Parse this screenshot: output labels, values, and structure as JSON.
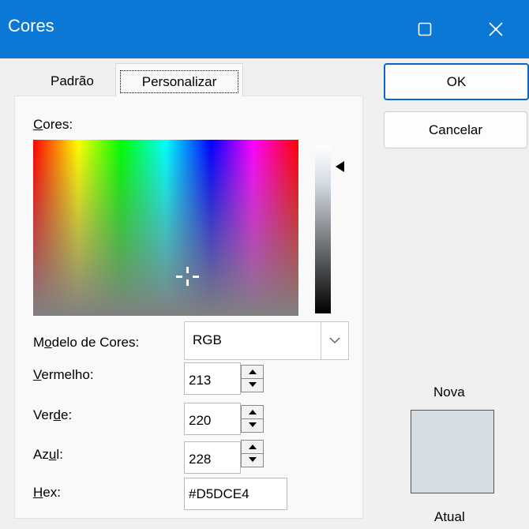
{
  "window": {
    "title": "Cores",
    "maximize_icon": "maximize-icon",
    "close_icon": "close-icon"
  },
  "tabs": [
    {
      "label": "Padrão",
      "selected": false
    },
    {
      "label": "Personalizar",
      "selected": true
    }
  ],
  "colors_label": {
    "mnemonic": "C",
    "rest": "ores:"
  },
  "color_model": {
    "label_pre": "M",
    "label_mnemonic": "o",
    "label_post": "delo de Cores:",
    "value": "RGB"
  },
  "red": {
    "label_mnemonic": "V",
    "label_rest": "ermelho:",
    "value": "213"
  },
  "green": {
    "label_pre": "Ver",
    "label_mnemonic": "d",
    "label_post": "e:",
    "value": "220"
  },
  "blue": {
    "label_pre": "Az",
    "label_mnemonic": "u",
    "label_post": "l:",
    "value": "228"
  },
  "hex": {
    "label_mnemonic": "H",
    "label_rest": "ex:",
    "value": "#D5DCE4"
  },
  "buttons": {
    "ok": "OK",
    "cancel": "Cancelar"
  },
  "preview": {
    "new_label": "Nova",
    "current_label": "Atual",
    "color": "#D5DCE4"
  },
  "colors": {
    "titlebar": "#0A78D4",
    "accent_border": "#0A66C2"
  }
}
